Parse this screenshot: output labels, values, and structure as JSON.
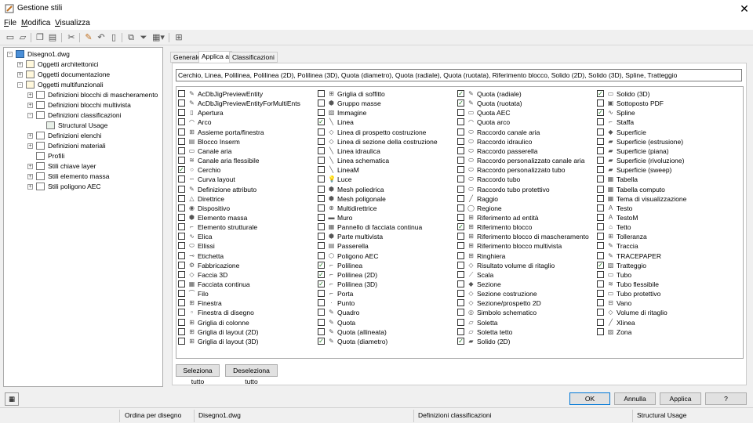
{
  "window": {
    "title": "Gestione stili",
    "close_glyph": "✕"
  },
  "menu": [
    "File",
    "Modifica",
    "Visualizza"
  ],
  "toolbar": [
    "new-icon",
    "open-icon",
    "copy-icon",
    "paste-icon",
    "purge-icon",
    "edit-icon",
    "undo-icon",
    "set-from-icon",
    "duplicate-icon",
    "filter-icon",
    "view-icon",
    "inventory-icon"
  ],
  "tree": [
    {
      "label": "Disegno1.dwg",
      "level": 0,
      "exp": "-",
      "icon": "drawing-icon"
    },
    {
      "label": "Oggetti architettonici",
      "level": 1,
      "exp": "+",
      "icon": "folder-icon"
    },
    {
      "label": "Oggetti documentazione",
      "level": 1,
      "exp": "+",
      "icon": "folder-icon"
    },
    {
      "label": "Oggetti multifunzionali",
      "level": 1,
      "exp": "-",
      "icon": "folder-icon"
    },
    {
      "label": "Definizioni blocchi di mascheramento",
      "level": 2,
      "exp": "+",
      "icon": "mask-icon"
    },
    {
      "label": "Definizioni blocchi multivista",
      "level": 2,
      "exp": "+",
      "icon": "mvblock-icon"
    },
    {
      "label": "Definizioni classificazioni",
      "level": 2,
      "exp": "-",
      "icon": "classification-icon"
    },
    {
      "label": "Structural Usage",
      "level": 3,
      "exp": "",
      "icon": "usage-icon"
    },
    {
      "label": "Definizioni elenchi",
      "level": 2,
      "exp": "+",
      "icon": "list-icon"
    },
    {
      "label": "Definizioni materiali",
      "level": 2,
      "exp": "+",
      "icon": "material-icon"
    },
    {
      "label": "Profili",
      "level": 2,
      "exp": "",
      "icon": "profile-icon"
    },
    {
      "label": "Stili chiave layer",
      "level": 2,
      "exp": "+",
      "icon": "layerkey-icon"
    },
    {
      "label": "Stili elemento massa",
      "level": 2,
      "exp": "+",
      "icon": "mass-icon"
    },
    {
      "label": "Stili poligono AEC",
      "level": 2,
      "exp": "+",
      "icon": "polygon-icon"
    }
  ],
  "tabs": [
    "Generale",
    "Applica a",
    "Classificazioni"
  ],
  "active_tab": 1,
  "summary": "Cerchio, Linea, Polilinea, Polilinea (2D), Polilinea (3D), Quota (diametro), Quota (radiale), Quota (ruotata), Riferimento blocco, Solido (2D), Solido (3D), Spline, Tratteggio",
  "columns": [
    [
      [
        "AcDbJigPreviewEntity",
        0,
        "✎"
      ],
      [
        "AcDbJigPreviewEntityForMultiEnts",
        0,
        "✎"
      ],
      [
        "Apertura",
        0,
        "▯"
      ],
      [
        "Arco",
        0,
        "◠"
      ],
      [
        "Assieme porta/finestra",
        0,
        "⊞"
      ],
      [
        "Blocco Inserm",
        0,
        "▤"
      ],
      [
        "Canale aria",
        0,
        "▭"
      ],
      [
        "Canale aria flessibile",
        0,
        "≋"
      ],
      [
        "Cerchio",
        1,
        "○"
      ],
      [
        "Curva layout",
        0,
        "∽"
      ],
      [
        "Definizione attributo",
        0,
        "✎"
      ],
      [
        "Direttrice",
        0,
        "△"
      ],
      [
        "Dispositivo",
        0,
        "◉"
      ],
      [
        "Elemento massa",
        0,
        "⬢"
      ],
      [
        "Elemento strutturale",
        0,
        "⌐"
      ],
      [
        "Elica",
        0,
        "∿"
      ],
      [
        "Ellissi",
        0,
        "⬭"
      ],
      [
        "Etichetta",
        0,
        "⊸"
      ],
      [
        "Fabbricazione",
        0,
        "⚙"
      ],
      [
        "Faccia 3D",
        0,
        "◇"
      ],
      [
        "Facciata continua",
        0,
        "▦"
      ],
      [
        "Filo",
        0,
        "⌒"
      ],
      [
        "Finestra",
        0,
        "⊞"
      ],
      [
        "Finestra di disegno",
        0,
        "▫"
      ],
      [
        "Griglia di colonne",
        0,
        "⊞"
      ],
      [
        "Griglia di layout (2D)",
        0,
        "⊞"
      ],
      [
        "Griglia di layout (3D)",
        0,
        "⊞"
      ]
    ],
    [
      [
        "Griglia di soffitto",
        0,
        "⊞"
      ],
      [
        "Gruppo masse",
        0,
        "⬢"
      ],
      [
        "Immagine",
        0,
        "▨"
      ],
      [
        "Linea",
        1,
        "╲"
      ],
      [
        "Linea di prospetto costruzione",
        0,
        "◇"
      ],
      [
        "Linea di sezione della costruzione",
        0,
        "◇"
      ],
      [
        "Linea idraulica",
        0,
        "╲"
      ],
      [
        "Linea schematica",
        0,
        "╲"
      ],
      [
        "LineaM",
        0,
        "╲"
      ],
      [
        "Luce",
        0,
        "💡"
      ],
      [
        "Mesh poliedrica",
        0,
        "⬢"
      ],
      [
        "Mesh poligonale",
        0,
        "⬢"
      ],
      [
        "Multidirettrice",
        0,
        "⊕"
      ],
      [
        "Muro",
        0,
        "▬"
      ],
      [
        "Pannello di facciata continua",
        0,
        "▦"
      ],
      [
        "Parte multivista",
        0,
        "⬢"
      ],
      [
        "Passerella",
        0,
        "▤"
      ],
      [
        "Poligono AEC",
        0,
        "⬡"
      ],
      [
        "Polilinea",
        1,
        "⌐"
      ],
      [
        "Polilinea (2D)",
        1,
        "⌐"
      ],
      [
        "Polilinea (3D)",
        1,
        "⌐"
      ],
      [
        "Porta",
        0,
        "⌐"
      ],
      [
        "Punto",
        0,
        "·"
      ],
      [
        "Quadro",
        0,
        "✎"
      ],
      [
        "Quota",
        0,
        "✎"
      ],
      [
        "Quota (allineata)",
        0,
        "✎"
      ],
      [
        "Quota (diametro)",
        1,
        "✎"
      ]
    ],
    [
      [
        "Quota (radiale)",
        1,
        "✎"
      ],
      [
        "Quota (ruotata)",
        1,
        "✎"
      ],
      [
        "Quota AEC",
        0,
        "▭"
      ],
      [
        "Quota arco",
        0,
        "◠"
      ],
      [
        "Raccordo canale aria",
        0,
        "⬭"
      ],
      [
        "Raccordo idraulico",
        0,
        "⬭"
      ],
      [
        "Raccordo passerella",
        0,
        "⬭"
      ],
      [
        "Raccordo personalizzato canale aria",
        0,
        "⬭"
      ],
      [
        "Raccordo personalizzato tubo",
        0,
        "⬭"
      ],
      [
        "Raccordo tubo",
        0,
        "⬭"
      ],
      [
        "Raccordo tubo protettivo",
        0,
        "⬭"
      ],
      [
        "Raggio",
        0,
        "╱"
      ],
      [
        "Regione",
        0,
        "◯"
      ],
      [
        "Riferimento ad entità",
        0,
        "⊞"
      ],
      [
        "Riferimento blocco",
        1,
        "⊞"
      ],
      [
        "Riferimento blocco di mascheramento",
        0,
        "⊞"
      ],
      [
        "Riferimento blocco multivista",
        0,
        "⊞"
      ],
      [
        "Ringhiera",
        0,
        "⊞"
      ],
      [
        "Risultato volume di ritaglio",
        0,
        "◇"
      ],
      [
        "Scala",
        0,
        "⟋"
      ],
      [
        "Sezione",
        0,
        "◆"
      ],
      [
        "Sezione costruzione",
        0,
        "◇"
      ],
      [
        "Sezione/prospetto 2D",
        0,
        "◇"
      ],
      [
        "Simbolo schematico",
        0,
        "◎"
      ],
      [
        "Soletta",
        0,
        "▱"
      ],
      [
        "Soletta tetto",
        0,
        "▱"
      ],
      [
        "Solido (2D)",
        1,
        "▰"
      ]
    ],
    [
      [
        "Solido (3D)",
        1,
        "▭"
      ],
      [
        "Sottoposto PDF",
        0,
        "▣"
      ],
      [
        "Spline",
        1,
        "∿"
      ],
      [
        "Staffa",
        0,
        "⌐"
      ],
      [
        "Superficie",
        0,
        "◆"
      ],
      [
        "Superficie (estrusione)",
        0,
        "▰"
      ],
      [
        "Superficie (piana)",
        0,
        "▰"
      ],
      [
        "Superficie (rivoluzione)",
        0,
        "▰"
      ],
      [
        "Superficie (sweep)",
        0,
        "▰"
      ],
      [
        "Tabella",
        0,
        "▦"
      ],
      [
        "Tabella computo",
        0,
        "▦"
      ],
      [
        "Tema di visualizzazione",
        0,
        "▦"
      ],
      [
        "Testo",
        0,
        "A"
      ],
      [
        "TestoM",
        0,
        "A"
      ],
      [
        "Tetto",
        0,
        "⌂"
      ],
      [
        "Tolleranza",
        0,
        "⊞"
      ],
      [
        "Traccia",
        0,
        "✎"
      ],
      [
        "TRACEPAPER",
        0,
        "✎"
      ],
      [
        "Tratteggio",
        1,
        "▨"
      ],
      [
        "Tubo",
        0,
        "▭"
      ],
      [
        "Tubo flessibile",
        0,
        "≋"
      ],
      [
        "Tubo protettivo",
        0,
        "▭"
      ],
      [
        "Vano",
        0,
        "⊟"
      ],
      [
        "Volume di ritaglio",
        0,
        "◇"
      ],
      [
        "Xlinea",
        0,
        "╱"
      ],
      [
        "Zona",
        0,
        "▨"
      ]
    ]
  ],
  "buttons": {
    "select_all": "Seleziona tutto",
    "deselect_all": "Deseleziona tutto",
    "ok": "OK",
    "cancel": "Annulla",
    "apply": "Applica",
    "help": "?"
  },
  "status": {
    "order": "Ordina per disegno",
    "drawing": "Disegno1.dwg",
    "category": "Definizioni classificazioni",
    "style": "Structural Usage"
  }
}
